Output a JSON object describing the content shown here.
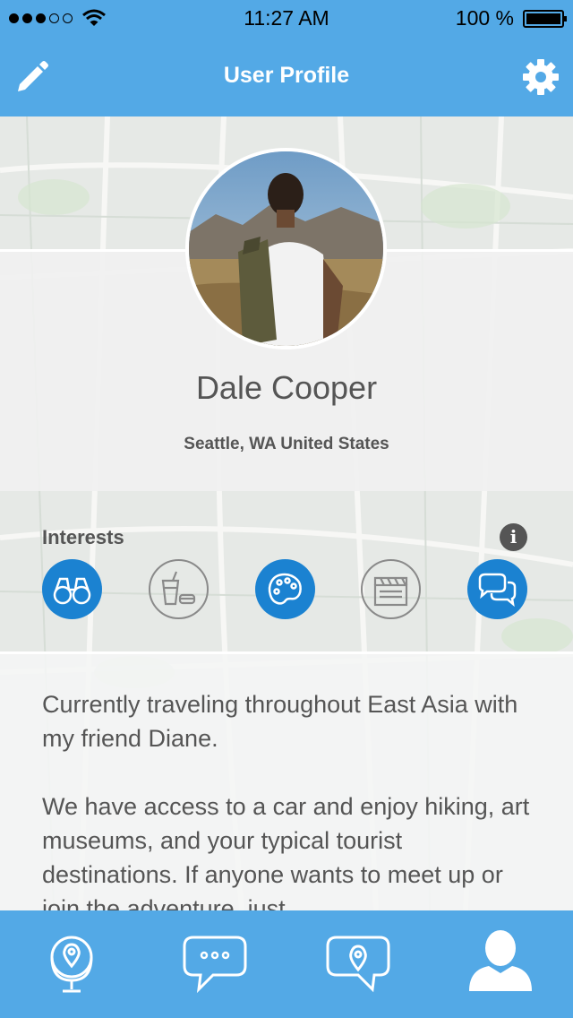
{
  "status_bar": {
    "time": "11:27 AM",
    "battery": "100 %",
    "signal_bars_filled": 3,
    "signal_bars_total": 5
  },
  "nav": {
    "title": "User Profile",
    "left_icon": "pencil-icon",
    "right_icon": "gear-icon"
  },
  "profile": {
    "name": "Dale Cooper",
    "location": "Seattle, WA  United States"
  },
  "interests": {
    "label": "Interests",
    "info_icon": "i",
    "items": [
      {
        "icon": "binoculars-icon",
        "active": true
      },
      {
        "icon": "food-drink-icon",
        "active": false
      },
      {
        "icon": "palette-icon",
        "active": true
      },
      {
        "icon": "clapperboard-icon",
        "active": false
      },
      {
        "icon": "chat-bubbles-icon",
        "active": true
      }
    ]
  },
  "bio": {
    "text": "Currently traveling throughout East Asia with my friend Diane.\n\nWe have access to a car and enjoy hiking, art museums, and your typical tourist destinations. If anyone wants to meet up or join the adventure, just"
  },
  "tab_bar": {
    "items": [
      {
        "icon": "globe-pin-icon"
      },
      {
        "icon": "chat-icon"
      },
      {
        "icon": "location-chat-icon"
      },
      {
        "icon": "user-icon"
      }
    ]
  },
  "colors": {
    "brand_blue": "#53a9e6",
    "active_interest": "#1b82d1",
    "text_gray": "#555555"
  }
}
